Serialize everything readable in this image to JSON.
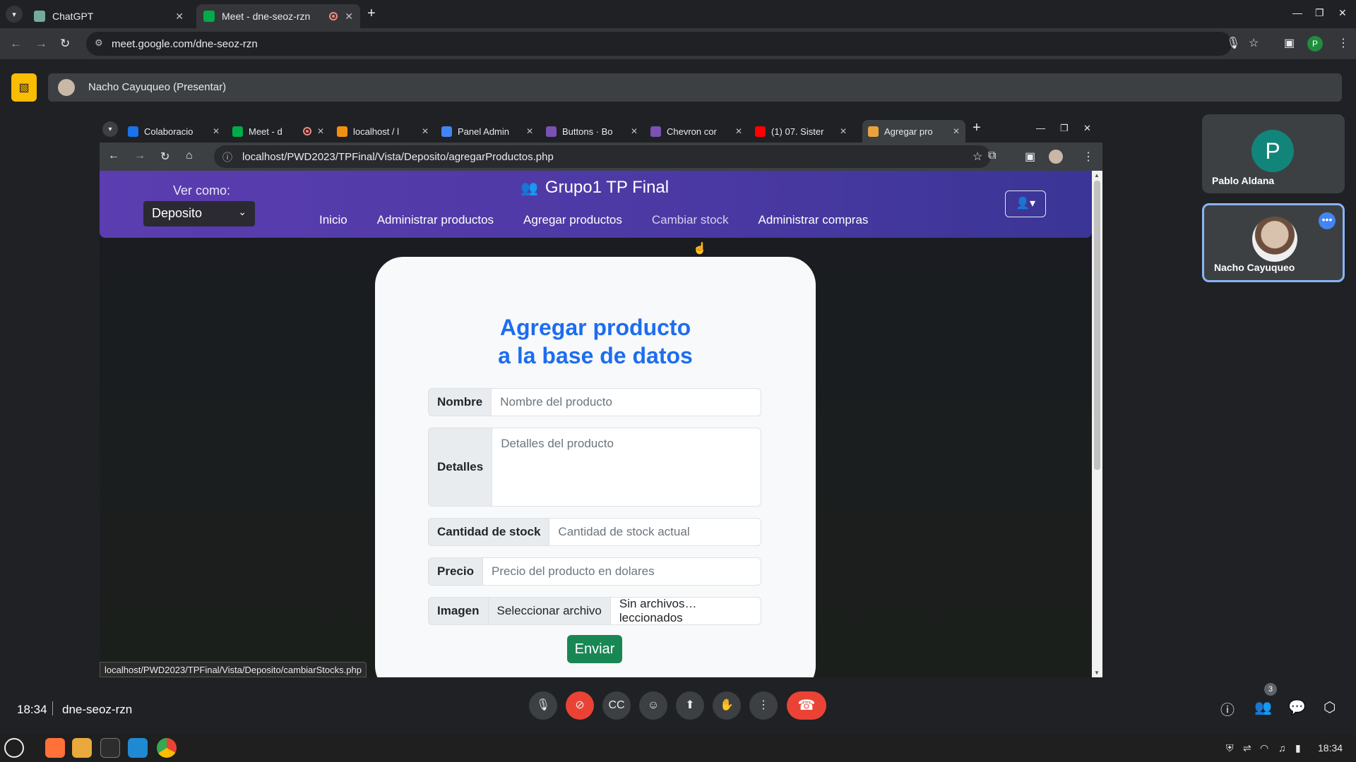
{
  "outer_browser": {
    "tabs": [
      {
        "title": "ChatGPT",
        "favicon_color": "#74aa9c",
        "active": false
      },
      {
        "title": "Meet - dne-seoz-rzn",
        "favicon_color": "#00ac47",
        "active": true,
        "recording": true
      }
    ],
    "url": "meet.google.com/dne-seoz-rzn",
    "profile_letter": "P"
  },
  "meet": {
    "presenter_label": "Nacho Cayuqueo (Presentar)",
    "participants": [
      {
        "name": "Pablo Aldana",
        "initial": "P",
        "avatar_color": "#12857a"
      },
      {
        "name": "Nacho Cayuqueo",
        "has_photo": true
      }
    ],
    "time": "18:34",
    "meeting_code": "dne-seoz-rzn",
    "people_count": "3"
  },
  "inner_browser": {
    "tabs": [
      {
        "title": "Colaboracio",
        "favicon_color": "#1a73e8",
        "active": false
      },
      {
        "title": "Meet - d",
        "favicon_color": "#00ac47",
        "active": false,
        "recording": true
      },
      {
        "title": "localhost / l",
        "favicon_color": "#f29111",
        "active": false
      },
      {
        "title": "Panel Admin",
        "favicon_color": "#4285f4",
        "active": false
      },
      {
        "title": "Buttons · Bo",
        "favicon_color": "#7952b3",
        "active": false
      },
      {
        "title": "Chevron cor",
        "favicon_color": "#7952b3",
        "active": false
      },
      {
        "title": "(1) 07. Sister",
        "favicon_color": "#ff0000",
        "active": false
      },
      {
        "title": "Agregar pro",
        "favicon_color": "#e8a33d",
        "active": true
      }
    ],
    "url": "localhost/PWD2023/TPFinal/Vista/Deposito/agregarProductos.php",
    "status_url": "localhost/PWD2023/TPFinal/Vista/Deposito/cambiarStocks.php"
  },
  "site": {
    "ver_como_label": "Ver como:",
    "ver_como_value": "Deposito",
    "brand": "Grupo1 TP Final",
    "nav": [
      "Inicio",
      "Administrar productos",
      "Agregar productos",
      "Cambiar stock",
      "Administrar compras"
    ],
    "form": {
      "title_line1": "Agregar producto",
      "title_line2": "a la base de datos",
      "nombre_label": "Nombre",
      "nombre_placeholder": "Nombre del producto",
      "detalles_label": "Detalles",
      "detalles_placeholder": "Detalles del producto",
      "stock_label": "Cantidad de stock",
      "stock_placeholder": "Cantidad de stock actual",
      "precio_label": "Precio",
      "precio_placeholder": "Precio del producto en dolares",
      "imagen_label": "Imagen",
      "file_button": "Seleccionar archivo",
      "file_status": "Sin archivos…leccionados",
      "submit": "Enviar"
    }
  },
  "taskbar": {
    "time": "18:34",
    "apps": [
      {
        "name": "firefox",
        "color": "#ff7139"
      },
      {
        "name": "files",
        "color": "#e9a93c"
      },
      {
        "name": "terminal",
        "color": "#2d2d2d"
      },
      {
        "name": "vscode",
        "color": "#1f8ad2"
      },
      {
        "name": "chrome",
        "color": "#4285f4"
      }
    ]
  }
}
